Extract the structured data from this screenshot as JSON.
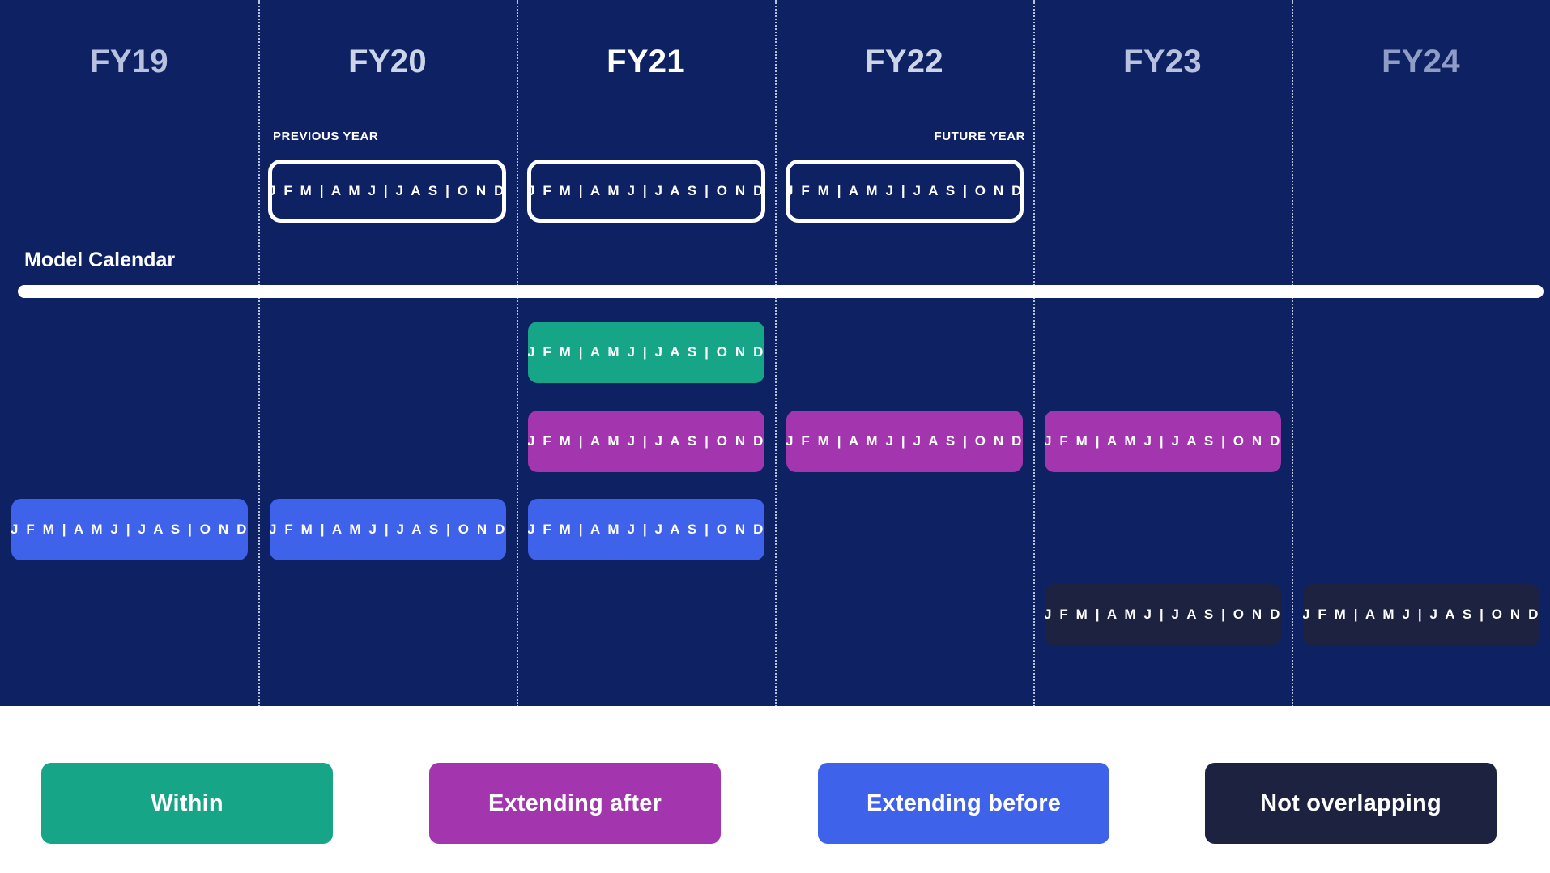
{
  "colors": {
    "canvas_navy": "#0E2263",
    "within_green": "#17A587",
    "extending_after_magenta": "#A336AE",
    "extending_before_blue": "#3F62EA",
    "not_overlapping_dark": "#1D2240",
    "rail_white": "#FFFFFF",
    "separator": "#D7DCED"
  },
  "quarters_label": "J F M | A M J | J A S | O N D",
  "model_calendar": {
    "title": "Model Calendar",
    "previous_year_caption": "PREVIOUS YEAR",
    "future_year_caption": "FUTURE YEAR",
    "boxes": [
      {
        "year": "FY20",
        "label": "J F M | A M J | J A S | O N D"
      },
      {
        "year": "FY21",
        "label": "J F M | A M J | J A S | O N D"
      },
      {
        "year": "FY22",
        "label": "J F M | A M J | J A S | O N D"
      }
    ]
  },
  "columns": [
    {
      "label": "FY19",
      "emphasis": "dim"
    },
    {
      "label": "FY20",
      "emphasis": "mid"
    },
    {
      "label": "FY21",
      "emphasis": "current"
    },
    {
      "label": "FY22",
      "emphasis": "mid"
    },
    {
      "label": "FY23",
      "emphasis": "dim"
    },
    {
      "label": "FY24",
      "emphasis": "far"
    }
  ],
  "bars": [
    {
      "year": "FY19",
      "category": "Extending before",
      "color": "#3F62EA",
      "label": "J F M | A M J | J A S | O N D"
    },
    {
      "year": "FY20",
      "category": "Extending before",
      "color": "#3F62EA",
      "label": "J F M | A M J | J A S | O N D"
    },
    {
      "year": "FY21",
      "category": "Within",
      "color": "#17A587",
      "label": "J F M | A M J | J A S | O N D"
    },
    {
      "year": "FY21",
      "category": "Extending after",
      "color": "#A336AE",
      "label": "J F M | A M J | J A S | O N D"
    },
    {
      "year": "FY21",
      "category": "Extending before",
      "color": "#3F62EA",
      "label": "J F M | A M J | J A S | O N D"
    },
    {
      "year": "FY22",
      "category": "Extending after",
      "color": "#A336AE",
      "label": "J F M | A M J | J A S | O N D"
    },
    {
      "year": "FY23",
      "category": "Extending after",
      "color": "#A336AE",
      "label": "J F M | A M J | J A S | O N D"
    },
    {
      "year": "FY23",
      "category": "Not overlapping",
      "color": "#1D2240",
      "label": "J F M | A M J | J A S | O N D"
    },
    {
      "year": "FY24",
      "category": "Not overlapping",
      "color": "#1D2240",
      "label": "J F M | A M J | J A S | O N D"
    }
  ],
  "legend": [
    {
      "label": "Within",
      "color": "#17A587"
    },
    {
      "label": "Extending after",
      "color": "#A336AE"
    },
    {
      "label": "Extending before",
      "color": "#3F62EA"
    },
    {
      "label": "Not overlapping",
      "color": "#1D2240"
    }
  ]
}
